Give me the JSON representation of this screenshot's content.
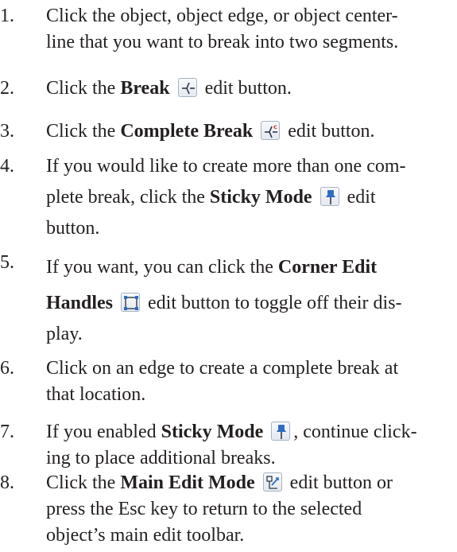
{
  "steps": [
    {
      "num": "1.",
      "line1": "Click the object, object edge, or object center-",
      "line2": "line that you want to break into two segments."
    },
    {
      "num": "2.",
      "pre": "Click the ",
      "bold": "Break",
      "post": " edit button.",
      "icon": "break-icon"
    },
    {
      "num": "3.",
      "pre": "Click the ",
      "bold": "Complete Break",
      "post": " edit button.",
      "icon": "complete-break-icon"
    },
    {
      "num": "4.",
      "line1": "If you would like to create more than one com-",
      "line2_pre": "plete break, click the ",
      "line2_bold": "Sticky Mode",
      "line2_post": " edit",
      "line3": "button.",
      "icon": "pushpin-icon"
    },
    {
      "num": "5.",
      "line1_pre": "If you want, you can click the ",
      "line1_bold": "Corner Edit",
      "line2_bold": "Handles",
      "line2_post": " edit button to toggle off their dis-",
      "line3": "play.",
      "icon": "corner-edit-handles-icon"
    },
    {
      "num": "6.",
      "line1": "Click on an edge to create a complete break at",
      "line2": "that location."
    },
    {
      "num": "7.",
      "line1_pre": "If you enabled ",
      "line1_bold": "Sticky Mode",
      "line1_post": ", continue click-",
      "line2": "ing to place additional breaks.",
      "icon": "pushpin-icon"
    },
    {
      "num": "8.",
      "line1_pre": "Click the ",
      "line1_bold": "Main Edit Mode",
      "line1_post": " edit button or",
      "line2": "press the Esc key to return to the selected",
      "line3": "object’s main edit toolbar.",
      "icon": "main-edit-mode-icon"
    }
  ],
  "colors": {
    "text": "#231f20",
    "icon_blue": "#2f6cc4",
    "icon_red": "#d8412f"
  }
}
